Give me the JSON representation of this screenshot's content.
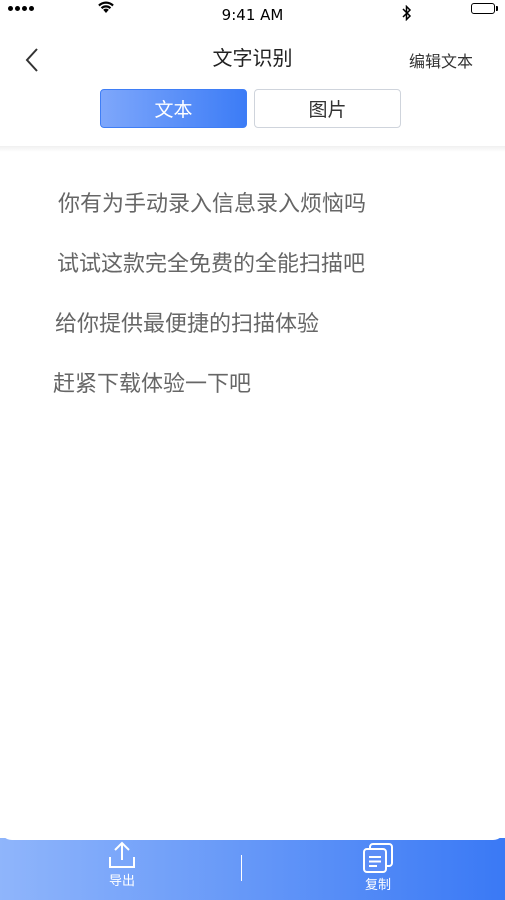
{
  "status_bar": {
    "time": "9:41 AM"
  },
  "header": {
    "title": "文字识别",
    "edit_button": "编辑文本"
  },
  "tabs": [
    {
      "label": "文本",
      "active": true
    },
    {
      "label": "图片",
      "active": false
    }
  ],
  "recognized_text": [
    "你有为手动录入信息录入烦恼吗",
    "试试这款完全免费的全能扫描吧",
    "给你提供最便捷的扫描体验",
    "赶紧下载体验一下吧"
  ],
  "bottom_bar": {
    "export_label": "导出",
    "copy_label": "复制"
  },
  "colors": {
    "accent_start": "#7ea7fb",
    "accent_end": "#3c7cf6",
    "text": "#666666"
  },
  "icons": {
    "back": "chevron-left-icon",
    "export": "upload-icon",
    "copy": "copy-document-icon"
  }
}
